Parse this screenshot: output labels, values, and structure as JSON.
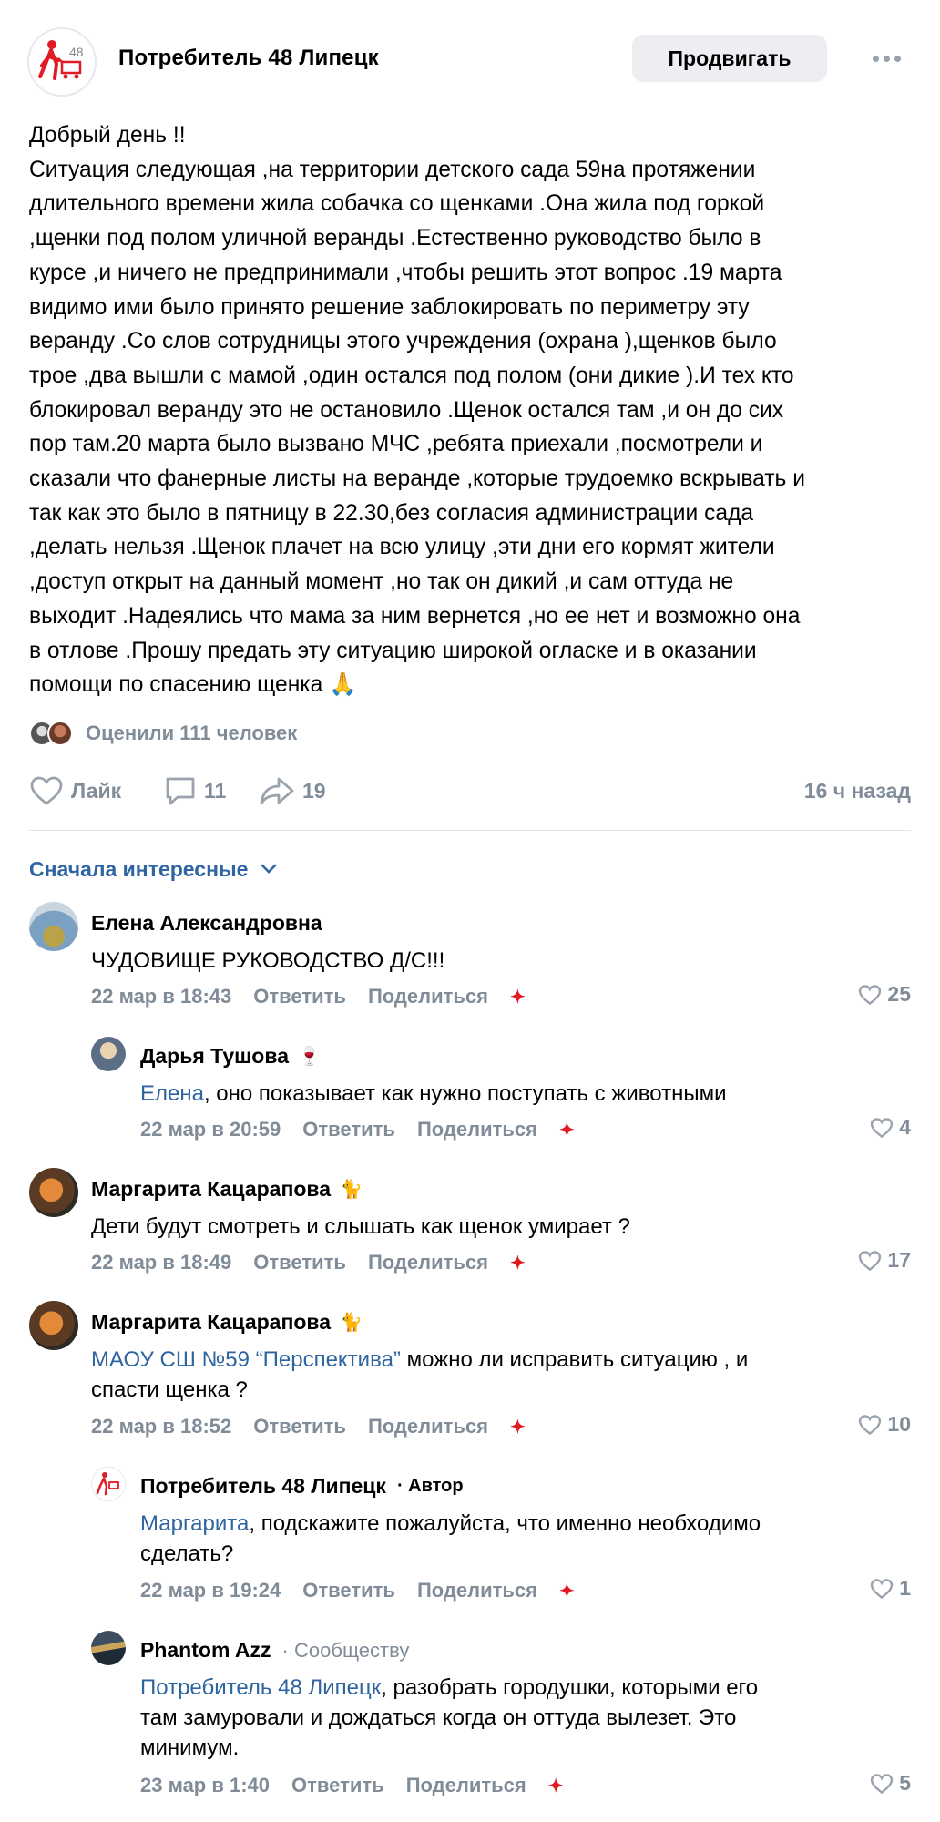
{
  "post": {
    "group_name": "Потребитель 48 Липецк",
    "promote_label": "Продвигать",
    "text": "Добрый день !!\nСитуация следующая ,на территории детского сада 59на протяжении\nдлительного времени жила собачка со щенками .Она жила под горкой\n,щенки под полом уличной веранды .Естественно руководство было в\nкурсе ,и ничего не предпринимали ,чтобы решить этот вопрос .19 марта\nвидимо ими было принято решение заблокировать по периметру эту\nверанду .Со слов сотрудницы этого учреждения (охрана ),щенков было\nтрое ,два вышли с мамой ,один остался под полом (они дикие ).И тех кто\nблокировал веранду это не остановило .Щенок остался там ,и он до сих\nпор там.20 марта было вызвано МЧС ,ребята приехали ,посмотрели и\nсказали что фанерные листы на веранде ,которые трудоемко вскрывать и\nтак как это было в пятницу в 22.30,без согласия администрации сада\n,делать нельзя .Щенок плачет на всю улицу ,эти дни его кормят жители\n,доступ открыт на данный момент ,но так он дикий ,и сам оттуда не\nвыходит .Надеялись что мама за ним вернется ,но ее нет и возможно она\nв отлове .Прошу предать эту ситуацию широкой огласке и в оказании\nпомощи по спасению щенка 🙏",
    "reactions_text": "Оценили 111 человек",
    "like_label": "Лайк",
    "comments_count": "11",
    "shares_count": "19",
    "time": "16 ч назад"
  },
  "sort_label": "Сначала интересные",
  "comments": [
    {
      "name": "Елена Александровна",
      "text": "ЧУДОВИЩЕ РУКОВОДСТВО Д/С!!!",
      "date": "22 мар в 18:43",
      "reply": "Ответить",
      "share": "Поделиться",
      "likes": "25"
    },
    {
      "name": "Дарья Тушова",
      "mention": "Елена",
      "text": ", оно показывает как нужно поступать с животными",
      "date": "22 мар в 20:59",
      "reply": "Ответить",
      "share": "Поделиться",
      "likes": "4"
    },
    {
      "name": "Маргарита Кацарапова",
      "text": "Дети будут смотреть и слышать как щенок умирает ?",
      "date": "22 мар в 18:49",
      "reply": "Ответить",
      "share": "Поделиться",
      "likes": "17"
    },
    {
      "name": "Маргарита Кацарапова",
      "mention": "МАОУ СШ №59 “Перспектива”",
      "text": " можно ли исправить ситуацию , и",
      "text2": "спасти щенка ?",
      "date": "22 мар в 18:52",
      "reply": "Ответить",
      "share": "Поделиться",
      "likes": "10"
    },
    {
      "name": "Потребитель 48 Липецк",
      "badge": "· Автор",
      "mention": "Маргарита",
      "text": ", подскажите пожалуйста, что именно необходимо",
      "text2": "сделать?",
      "date": "22 мар в 19:24",
      "reply": "Ответить",
      "share": "Поделиться",
      "likes": "1"
    },
    {
      "name": "Phantom Azz",
      "badge": "· Сообществу",
      "mention": "Потребитель 48 Липецк",
      "text": ", разобрать городушки, которыми его",
      "text2": "там замуровали и дождаться когда он оттуда вылезет. Это",
      "text3": "минимум.",
      "date": "23 мар в 1:40",
      "reply": "Ответить",
      "share": "Поделиться",
      "likes": "5"
    }
  ],
  "colors": {
    "accent": "#2d64a1",
    "muted": "#818c99",
    "brand_red": "#e01b24"
  }
}
